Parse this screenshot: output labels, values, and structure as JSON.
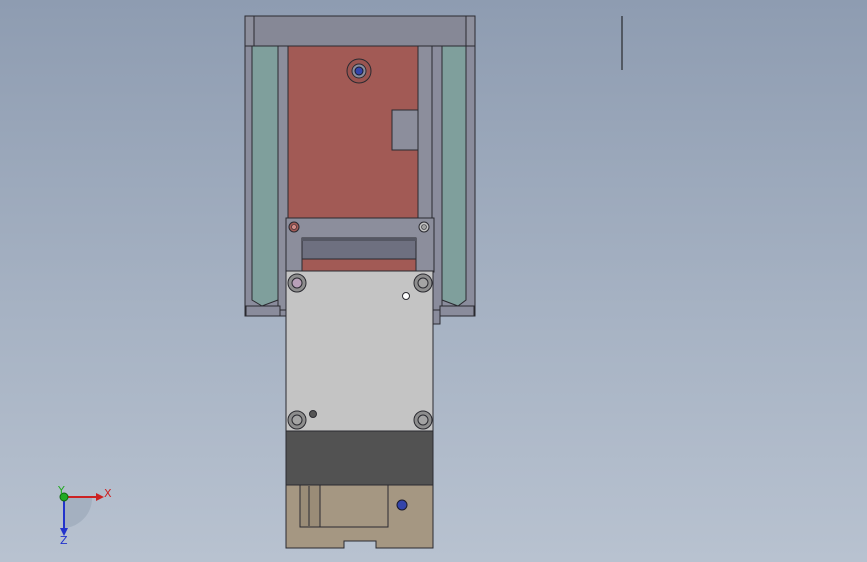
{
  "app": {
    "view": "cad-graphics-area"
  },
  "triad": {
    "x_label": "X",
    "y_label": "Y",
    "z_label": "Z"
  },
  "colors": {
    "background_top": "#8e9cb1",
    "background_bottom": "#b8c2d0",
    "frame": "#8a8c9c",
    "frame_dark": "#5c5e6c",
    "glass": "#7f9f9c",
    "motor_plate": "#a25a55",
    "carriage": "#c4c4c4",
    "block": "#525252",
    "base": "#a59782",
    "x_axis": "#cc2222",
    "y_axis": "#22aa22",
    "z_axis": "#2233cc"
  }
}
